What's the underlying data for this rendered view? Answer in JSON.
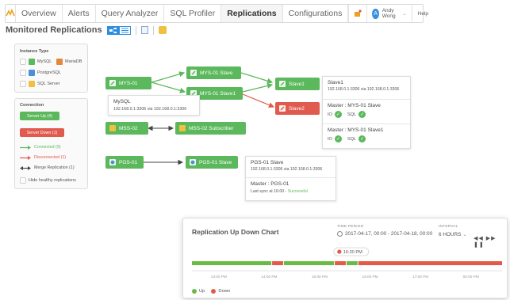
{
  "nav": {
    "tabs": [
      "Overview",
      "Alerts",
      "Query Analyzer",
      "SQL Profiler",
      "Replications",
      "Configurations"
    ],
    "active_tab": "Replications",
    "user": "Andy Wong",
    "avatar_initial": "A",
    "help": "Help"
  },
  "page_title": "Monitored Replications",
  "instance_panel": {
    "title": "Instance Type",
    "types": [
      "MySQL",
      "MariaDB",
      "PostgreSQL",
      "SQL Server"
    ]
  },
  "connection_panel": {
    "title": "Connection",
    "server_up": "Server Up (4)",
    "server_down": "Server Down (1)",
    "connected": "Connected (9)",
    "disconnected": "Disconnected (1)",
    "merge": "Merge Replication (1)",
    "hide": "Hide healthy replications"
  },
  "nodes": {
    "mys01": "MYS-01",
    "mys01_slave": "MYS-01 Slave",
    "mys01_slave1": "MYS-01 Slave1",
    "slave1": "Slave1",
    "slave2": "Slave2",
    "mss02": "MSS-02",
    "mss02_sub": "MSS-02 Subscriber",
    "pgs01": "PGS-01",
    "pgs01_slave": "PGS-01 Slave"
  },
  "mysql_info": {
    "name": "MySQL",
    "addr": "192.168.0.1:3306 via 192.168.0.1:3306"
  },
  "slave1_info": {
    "name": "Slave1",
    "addr": "192.168.0.1:3306 via 192.168.0.1:3306",
    "master1": "Master : MYS-01 Slave",
    "master2": "Master : MYS-01 Slave1",
    "io": "IO",
    "sql": "SQL"
  },
  "pgs_info": {
    "name": "PGS-01 Slave",
    "addr": "192.168.0.1:3306 via 192.168.0.1:3306",
    "master": "Master : PGS-01",
    "sync_prefix": "Last sync at 16:00 - ",
    "sync_status": "Successful"
  },
  "chart_card": {
    "title": "Replication Up Down Chart",
    "period_label": "TIME PERIOD",
    "period_value": "2017-04-17, 00:00 - 2017-04-18, 00:00",
    "interval_label": "INTERVAL",
    "interval_value": "6 HOURS",
    "marker": "16:20 PM",
    "legend_up": "Up",
    "legend_down": "Down"
  },
  "chart_data": {
    "type": "timeline",
    "x_ticks": [
      "13:00 PM",
      "14:00 PM",
      "15:00 PM",
      "16:00 PM",
      "17:00 PM",
      "00:00 PM"
    ],
    "segments": [
      {
        "state": "up",
        "start": 0.0,
        "end": 0.256
      },
      {
        "state": "down",
        "start": 0.256,
        "end": 0.294
      },
      {
        "state": "up",
        "start": 0.294,
        "end": 0.458
      },
      {
        "state": "down",
        "start": 0.458,
        "end": 0.496
      },
      {
        "state": "up",
        "start": 0.496,
        "end": 0.534
      },
      {
        "state": "down",
        "start": 0.534,
        "end": 1.0
      }
    ],
    "marker_position": 0.488,
    "colors": {
      "up": "#6abb45",
      "down": "#e45a48"
    }
  }
}
